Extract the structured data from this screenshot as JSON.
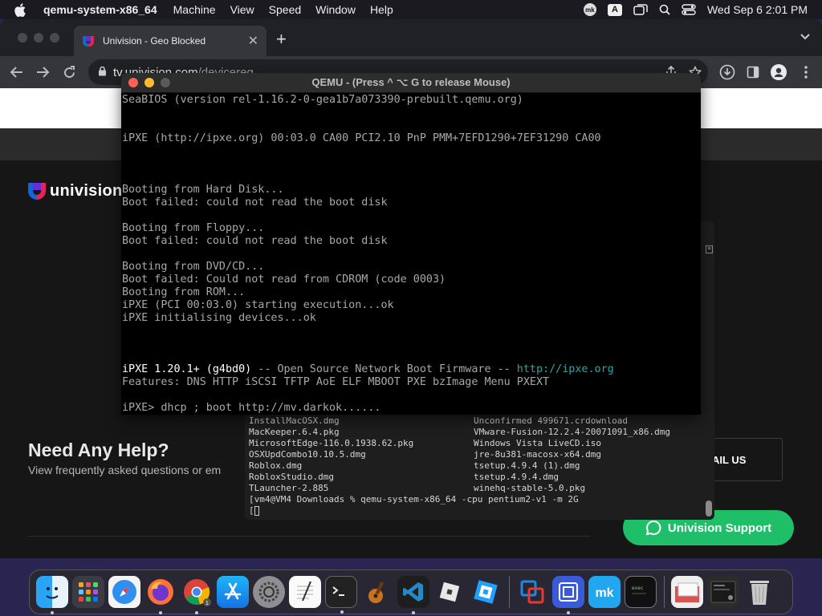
{
  "menubar": {
    "app_name": "qemu-system-x86_64",
    "menus": [
      "Machine",
      "View",
      "Speed",
      "Window",
      "Help"
    ],
    "mk_badge": "mk",
    "input_source": "A",
    "clock": "Wed Sep 6  2:01 PM"
  },
  "browser": {
    "tab_title": "Univision - Geo Blocked",
    "url_host": "tv.univision.com",
    "url_path": "/devicereg"
  },
  "page": {
    "logo_text": "univision",
    "help_title": "Need Any Help?",
    "help_subtitle": "View frequently asked questions or em",
    "email_button": "AIL US",
    "support_button": "Univision Support"
  },
  "terminal": {
    "files": [
      [
        "InstallMacOSX.dmg",
        "Unconfirmed 499671.crdownload"
      ],
      [
        "MacKeeper.6.4.pkg",
        "VMware-Fusion-12.2.4-20071091_x86.dmg"
      ],
      [
        "MicrosoftEdge-116.0.1938.62.pkg",
        "Windows Vista LiveCD.iso"
      ],
      [
        "OSXUpdCombo10.10.5.dmg",
        "jre-8u381-macosx-x64.dmg"
      ],
      [
        "Roblox.dmg",
        "tsetup.4.9.4 (1).dmg"
      ],
      [
        "RobloxStudio.dmg",
        "tsetup.4.9.4.dmg"
      ],
      [
        "TLauncher-2.885",
        "winehq-stable-5.0.pkg"
      ]
    ],
    "command": "[vm4@VM4 Downloads % qemu-system-x86_64 -cpu pentium2-v1 -m 2G"
  },
  "qemu": {
    "window_title": "QEMU - (Press  ^ ⌥ G  to release Mouse)",
    "lines": {
      "seabios": "SeaBIOS (version rel-1.16.2-0-gea1b7a073390-prebuilt.qemu.org)",
      "ipxe_pci": "iPXE (http://ipxe.org) 00:03.0 CA00 PCI2.10 PnP PMM+7EFD1290+7EF31290 CA00",
      "boot_hd": "Booting from Hard Disk...",
      "fail_hd": "Boot failed: could not read the boot disk",
      "boot_floppy": "Booting from Floppy...",
      "fail_floppy": "Boot failed: could not read the boot disk",
      "boot_dvd": "Booting from DVD/CD...",
      "fail_dvd": "Boot failed: Could not read from CDROM (code 0003)",
      "boot_rom": "Booting from ROM...",
      "ipxe_exec": "iPXE (PCI 00:03.0) starting execution...ok",
      "ipxe_init": "iPXE initialising devices...ok",
      "ipxe_version": "iPXE 1.20.1+ (g4bd0)",
      "ipxe_desc": " -- Open Source Network Boot Firmware -- ",
      "ipxe_url": "http://ipxe.org",
      "features": "Features: DNS HTTP iSCSI TFTP AoE ELF MBOOT PXE bzImage Menu PXEXT",
      "prompt": "iPXE> dhcp ; boot http://mv.darkok......"
    }
  },
  "colors": {
    "support_green": "#1fbf6a",
    "ipxe_cyan": "#2aa6a6",
    "close_red": "#fe5f57",
    "minimize_yellow": "#febc2e",
    "maximize_green": "#28c840"
  }
}
